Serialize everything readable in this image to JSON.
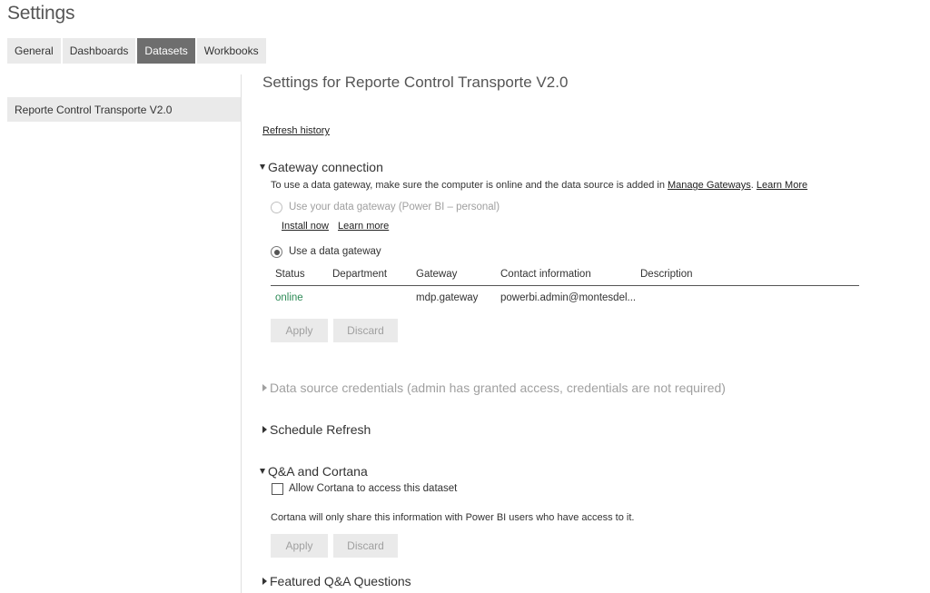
{
  "page": {
    "title": "Settings"
  },
  "tabs": [
    {
      "label": "General"
    },
    {
      "label": "Dashboards"
    },
    {
      "label": "Datasets"
    },
    {
      "label": "Workbooks"
    }
  ],
  "datasets": [
    {
      "label": "Reporte Control Transporte V2.0"
    }
  ],
  "main": {
    "heading": "Settings for Reporte Control Transporte V2.0",
    "refresh_history": "Refresh history",
    "gateway": {
      "title": "Gateway connection",
      "description_prefix": "To use a data gateway, make sure the computer is online and the data source is added in ",
      "manage_gateways": "Manage Gateways",
      "sep": ".",
      "learn_more": "Learn More",
      "personal_option": "Use your data gateway (Power BI – personal)",
      "install_now": "Install now",
      "learn_more_small": "Learn more",
      "gateway_option": "Use a data gateway",
      "table": {
        "headers": [
          "Status",
          "Department",
          "Gateway",
          "Contact information",
          "Description"
        ],
        "row": {
          "status": "online",
          "department": "",
          "gateway": "mdp.gateway",
          "contact": "powerbi.admin@montesdel...",
          "description": ""
        }
      },
      "apply": "Apply",
      "discard": "Discard"
    },
    "credentials": {
      "title": "Data source credentials (admin has granted access, credentials are not required)"
    },
    "schedule": {
      "title": "Schedule Refresh"
    },
    "qna": {
      "title": "Q&A and Cortana",
      "checkbox_label": "Allow Cortana to access this dataset",
      "note": "Cortana will only share this information with Power BI users who have access to it.",
      "apply": "Apply",
      "discard": "Discard"
    },
    "featured": {
      "title": "Featured Q&A Questions"
    }
  },
  "colors": {
    "active_tab": "#6e6e6e",
    "tab_bg": "#eaeaea",
    "online": "#2e8b57",
    "disabled_text": "#a0a0a0"
  }
}
